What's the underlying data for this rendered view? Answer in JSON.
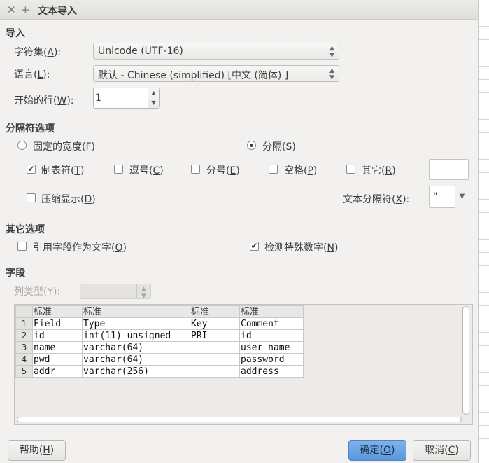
{
  "window": {
    "title": "文本导入",
    "close_glyph": "✕",
    "pin_glyph": "+"
  },
  "import": {
    "section_title": "导入",
    "charset_label": "字符集",
    "charset_key": "A",
    "charset_value": "Unicode (UTF-16)",
    "language_label": "语言",
    "language_key": "L",
    "language_value": "默认 - Chinese (simplified) [中文 (简体) ]",
    "start_row_label": "开始的行",
    "start_row_key": "W",
    "start_row_value": "1"
  },
  "separator": {
    "section_title": "分隔符选项",
    "fixed_width_label": "固定的宽度",
    "fixed_width_key": "F",
    "separated_label": "分隔",
    "separated_key": "S",
    "tab_label": "制表符",
    "tab_key": "T",
    "tab_checked": true,
    "comma_label": "逗号",
    "comma_key": "C",
    "semicolon_label": "分号",
    "semicolon_key": "E",
    "space_label": "空格",
    "space_key": "P",
    "other_label": "其它",
    "other_key": "R",
    "merge_label": "压缩显示",
    "merge_key": "D",
    "text_delim_label": "文本分隔符",
    "text_delim_key": "X",
    "text_delim_value": "\""
  },
  "other_options": {
    "section_title": "其它选项",
    "quoted_as_text_label": "引用字段作为文字",
    "quoted_as_text_key": "Q",
    "detect_special_numbers_label": "检测特殊数字",
    "detect_special_numbers_key": "N"
  },
  "fields": {
    "section_title": "字段",
    "column_type_label": "列类型",
    "column_type_key": "Y",
    "headers": [
      "标准",
      "标准",
      "标准",
      "标准"
    ],
    "rows": [
      {
        "n": "1",
        "c": [
          "Field",
          "Type",
          "Key",
          "Comment"
        ]
      },
      {
        "n": "2",
        "c": [
          "id",
          "int(11) unsigned",
          "PRI",
          "id"
        ]
      },
      {
        "n": "3",
        "c": [
          "name",
          "varchar(64)",
          "",
          "user name"
        ]
      },
      {
        "n": "4",
        "c": [
          "pwd",
          "varchar(64)",
          "",
          "password"
        ]
      },
      {
        "n": "5",
        "c": [
          "addr",
          "varchar(256)",
          "",
          "address"
        ]
      }
    ]
  },
  "buttons": {
    "help_label": "帮助",
    "help_key": "H",
    "ok_label": "确定",
    "ok_key": "O",
    "cancel_label": "取消",
    "cancel_key": "C"
  }
}
